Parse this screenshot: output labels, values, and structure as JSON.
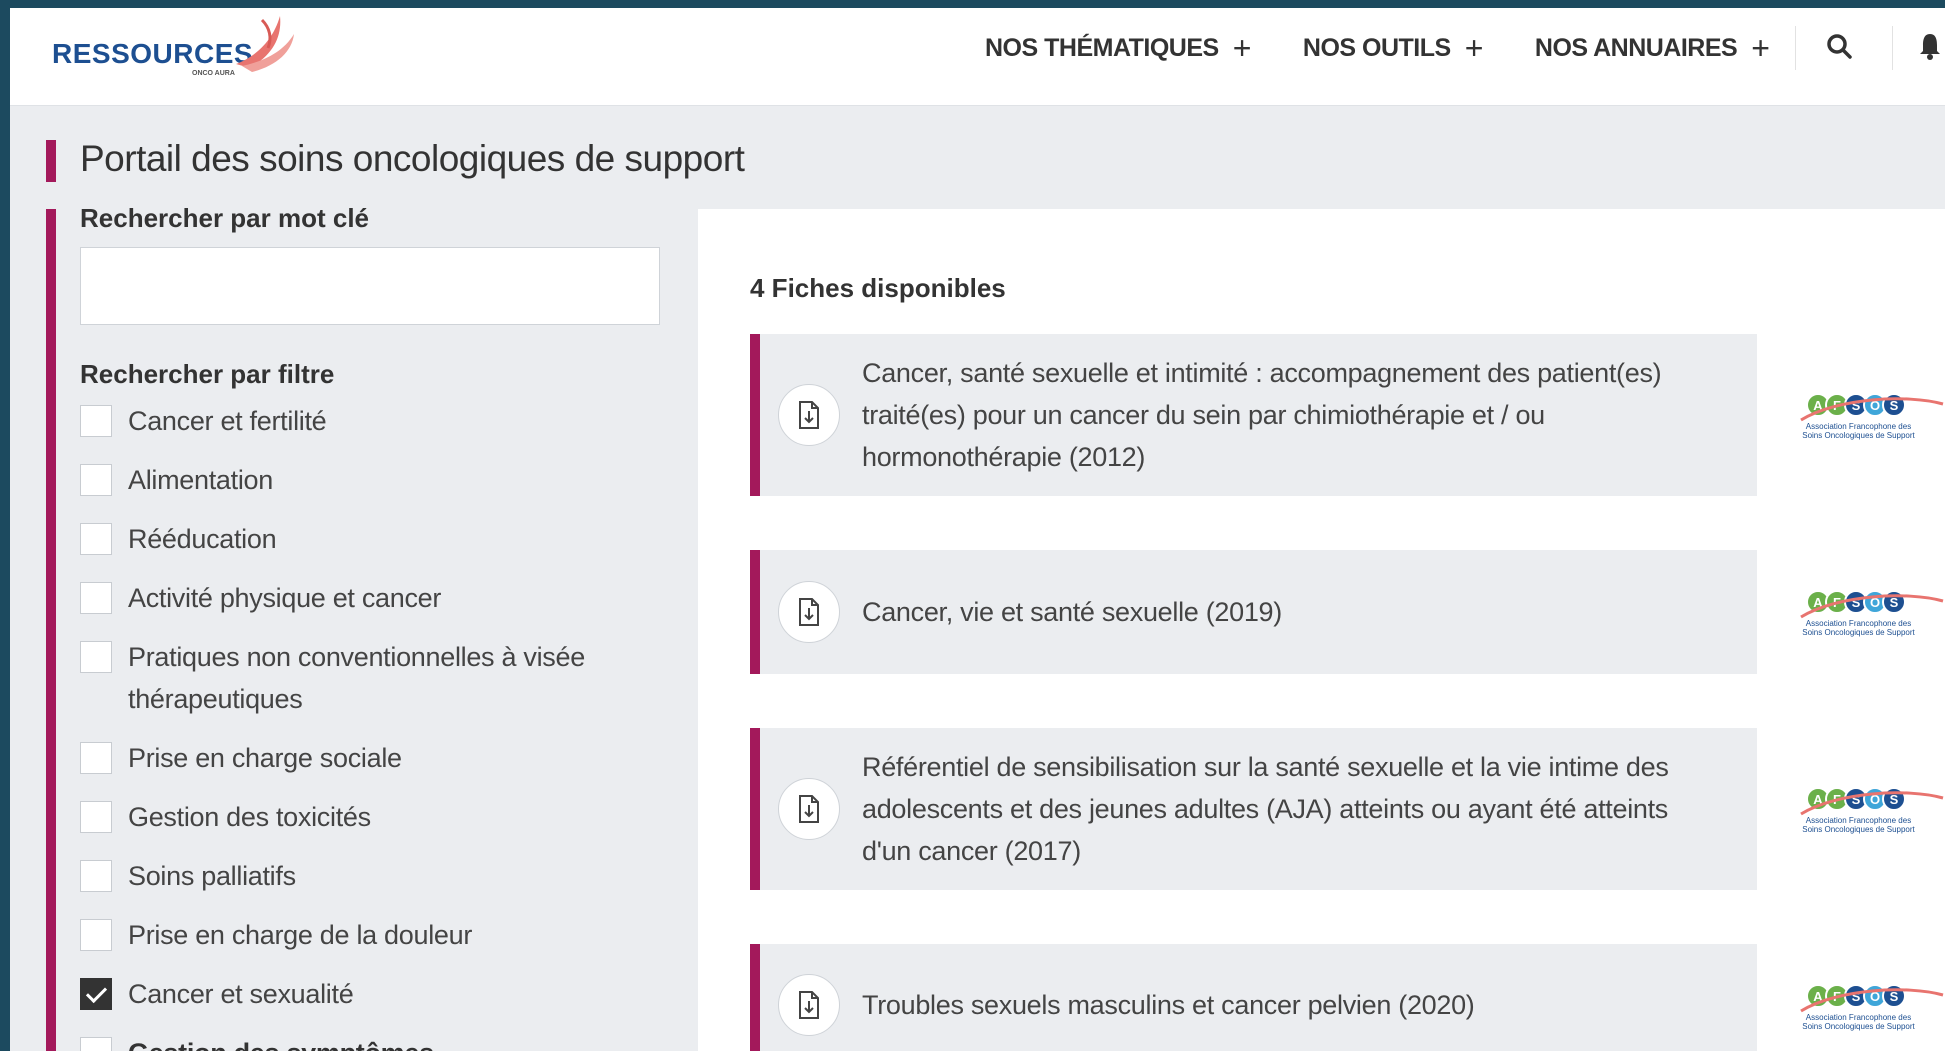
{
  "header": {
    "logo_text": "RESSOURCES",
    "logo_sub": "ONCO AURA",
    "nav": [
      {
        "label": "NOS THÉMATIQUES",
        "icon": "plus-icon"
      },
      {
        "label": "NOS OUTILS",
        "icon": "plus-icon"
      },
      {
        "label": "NOS ANNUAIRES",
        "icon": "plus-icon"
      }
    ],
    "search_icon": "search-icon",
    "notification_icon": "bell-icon"
  },
  "page": {
    "title": "Portail des soins oncologiques de support"
  },
  "sidebar": {
    "keyword_label": "Rechercher par mot clé",
    "keyword_value": "",
    "filter_label": "Rechercher par filtre",
    "filters": [
      {
        "label": "Cancer et fertilité",
        "checked": false
      },
      {
        "label": "Alimentation",
        "checked": false
      },
      {
        "label": "Rééducation",
        "checked": false
      },
      {
        "label": "Activité physique et cancer",
        "checked": false
      },
      {
        "label": "Pratiques non conventionnelles à visée thérapeutiques",
        "checked": false
      },
      {
        "label": "Prise en charge sociale",
        "checked": false
      },
      {
        "label": "Gestion des toxicités",
        "checked": false
      },
      {
        "label": "Soins palliatifs",
        "checked": false
      },
      {
        "label": "Prise en charge de la douleur",
        "checked": false
      },
      {
        "label": "Cancer et sexualité",
        "checked": true
      },
      {
        "label": "Gestion des symptômes",
        "checked": false
      }
    ]
  },
  "main": {
    "count_text": "4 Fiches disponibles",
    "fiches": [
      {
        "title": "Cancer, santé sexuelle et intimité : accompagnement des patient(es) traité(es) pour un cancer du sein par chimiothérapie et / ou hormonothérapie (2012)",
        "logo": "afsos-logo"
      },
      {
        "title": "Cancer, vie et santé sexuelle (2019)",
        "logo": "afsos-logo"
      },
      {
        "title": "Référentiel de sensibilisation sur la santé sexuelle et la vie intime des adolescents et des jeunes adultes (AJA) atteints ou ayant été atteints d'un cancer (2017)",
        "logo": "afsos-logo"
      },
      {
        "title": "Troubles sexuels masculins et cancer pelvien (2020)",
        "logo": "afsos-logo"
      }
    ],
    "afsos": {
      "letters": [
        "A",
        "F",
        "S",
        "O",
        "S"
      ],
      "caption_1": "Association Francophone des",
      "caption_2": "Soins Oncologiques de Support"
    }
  },
  "colors": {
    "accent": "#a3195b",
    "brand_blue": "#1d4f91",
    "logo_coral": "#e8746f",
    "afsos_green": "#6bb04a",
    "afsos_blue": "#1d4f91",
    "afsos_light_blue": "#3fa6d9"
  }
}
